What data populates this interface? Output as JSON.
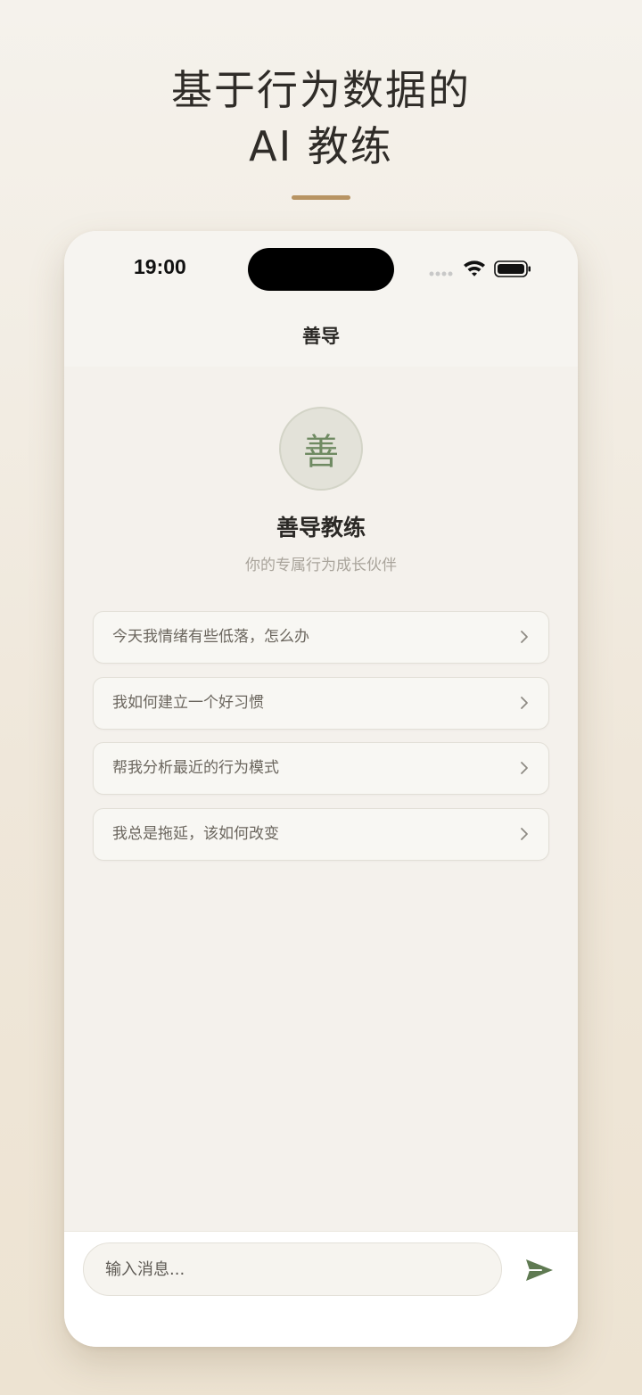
{
  "hero": {
    "line1": "基于行为数据的",
    "line2": "AI 教练"
  },
  "status_bar": {
    "time": "19:00",
    "icons": [
      "signal-dots-icon",
      "wifi-icon",
      "battery-icon"
    ]
  },
  "nav": {
    "title": "善导"
  },
  "coach": {
    "avatar_char": "善",
    "name": "善导教练",
    "subtitle": "你的专属行为成长伙伴"
  },
  "suggestions": [
    {
      "label": "今天我情绪有些低落，怎么办"
    },
    {
      "label": "我如何建立一个好习惯"
    },
    {
      "label": "帮我分析最近的行为模式"
    },
    {
      "label": "我总是拖延，该如何改变"
    }
  ],
  "composer": {
    "placeholder": "输入消息...",
    "send_icon": "send-icon"
  },
  "colors": {
    "accent_gold": "#b89463",
    "accent_green": "#5f7a52",
    "avatar_text": "#6f8a62"
  }
}
